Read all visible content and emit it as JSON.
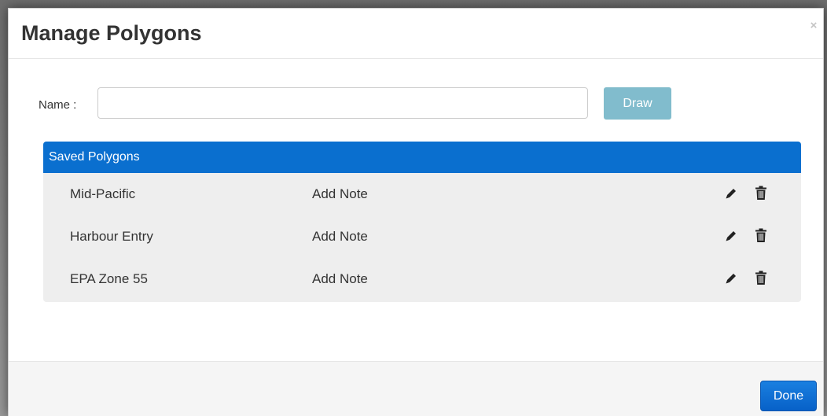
{
  "dialog": {
    "title": "Manage Polygons",
    "close_label": "×"
  },
  "form": {
    "name_label": "Name :",
    "name_value": "",
    "name_placeholder": "",
    "draw_label": "Draw"
  },
  "saved_polygons": {
    "heading": "Saved Polygons",
    "items": [
      {
        "name": "Mid-Pacific",
        "note": "Add Note",
        "edit_icon": "pencil-icon",
        "delete_icon": "trash-icon"
      },
      {
        "name": "Harbour Entry",
        "note": "Add Note",
        "edit_icon": "pencil-icon",
        "delete_icon": "trash-icon"
      },
      {
        "name": "EPA Zone 55",
        "note": "Add Note",
        "edit_icon": "pencil-icon",
        "delete_icon": "trash-icon"
      }
    ]
  },
  "footer": {
    "done_label": "Done"
  },
  "colors": {
    "panel_heading": "#0a6fcf",
    "panel_body": "#eeeeee",
    "draw_button": "#81bccd",
    "done_button": "#0b6ad0",
    "title_text": "#333333"
  }
}
